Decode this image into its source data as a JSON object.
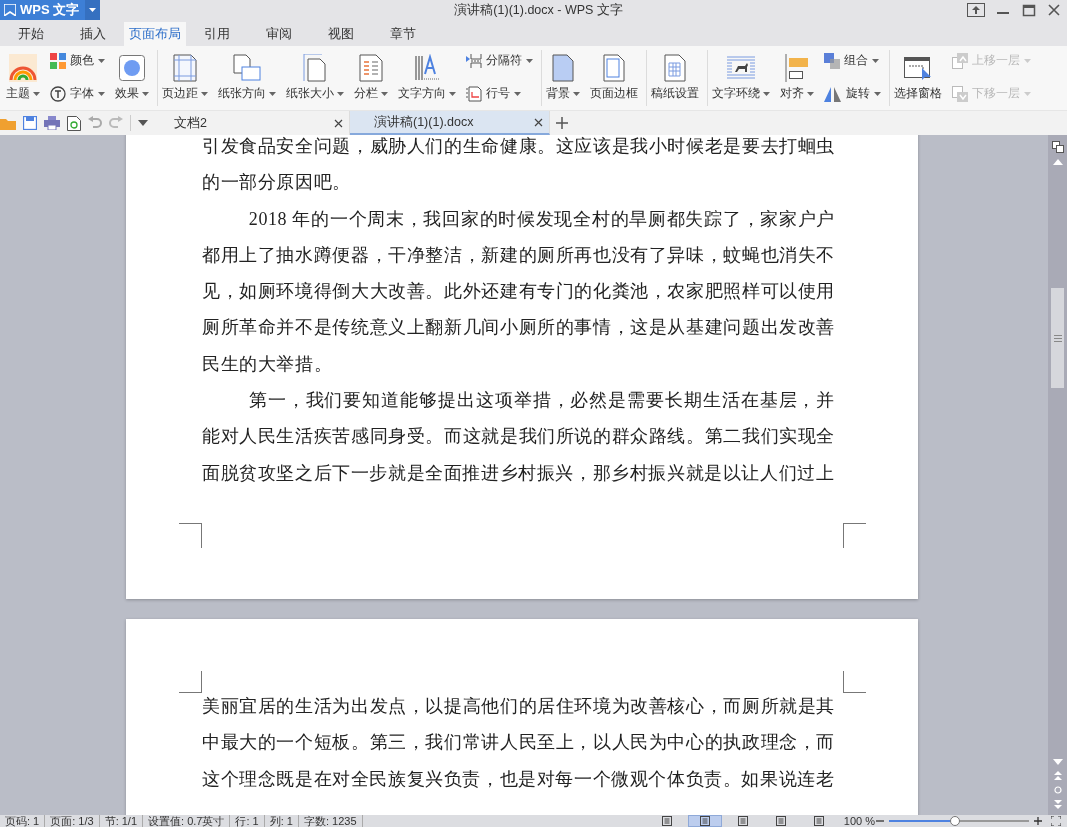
{
  "window": {
    "app_name": "WPS 文字",
    "title": "演讲稿(1)(1).docx - WPS 文字"
  },
  "tabs": [
    {
      "label": "开始",
      "selected": false
    },
    {
      "label": "插入",
      "selected": false
    },
    {
      "label": "页面布局",
      "selected": true
    },
    {
      "label": "引用",
      "selected": false
    },
    {
      "label": "审阅",
      "selected": false
    },
    {
      "label": "视图",
      "selected": false
    },
    {
      "label": "章节",
      "selected": false
    }
  ],
  "ribbon": {
    "groups": [
      {
        "items": [
          {
            "kind": "large",
            "label": "主题",
            "dropdown": true,
            "disabled": false
          },
          {
            "kind": "stack",
            "items": [
              {
                "label": "颜色",
                "dropdown": true,
                "disabled": false
              },
              {
                "label": "字体",
                "dropdown": true,
                "disabled": false
              }
            ]
          },
          {
            "kind": "large",
            "label": "效果",
            "dropdown": true,
            "disabled": false
          }
        ]
      },
      {
        "items": [
          {
            "kind": "large",
            "label": "页边距",
            "dropdown": true,
            "disabled": false
          },
          {
            "kind": "large",
            "label": "纸张方向",
            "dropdown": true,
            "disabled": false
          },
          {
            "kind": "large",
            "label": "纸张大小",
            "dropdown": true,
            "disabled": false
          },
          {
            "kind": "large",
            "label": "分栏",
            "dropdown": true,
            "disabled": false
          },
          {
            "kind": "large",
            "label": "文字方向",
            "dropdown": true,
            "disabled": false
          },
          {
            "kind": "stack",
            "items": [
              {
                "label": "分隔符",
                "dropdown": true,
                "disabled": false
              },
              {
                "label": "行号",
                "dropdown": true,
                "disabled": false
              }
            ]
          }
        ]
      },
      {
        "items": [
          {
            "kind": "large",
            "label": "背景",
            "dropdown": true,
            "disabled": false
          },
          {
            "kind": "large",
            "label": "页面边框",
            "dropdown": false,
            "disabled": false
          }
        ]
      },
      {
        "items": [
          {
            "kind": "large",
            "label": "稿纸设置",
            "dropdown": false,
            "disabled": false
          }
        ]
      },
      {
        "items": [
          {
            "kind": "large",
            "label": "文字环绕",
            "dropdown": true,
            "disabled": false
          },
          {
            "kind": "large",
            "label": "对齐",
            "dropdown": true,
            "disabled": false
          },
          {
            "kind": "stack",
            "items": [
              {
                "label": "组合",
                "dropdown": true,
                "disabled": false
              },
              {
                "label": "旋转",
                "dropdown": true,
                "disabled": false
              }
            ]
          }
        ]
      },
      {
        "items": [
          {
            "kind": "large",
            "label": "选择窗格",
            "dropdown": false,
            "disabled": false
          },
          {
            "kind": "stack",
            "items": [
              {
                "label": "上移一层",
                "dropdown": true,
                "disabled": true
              },
              {
                "label": "下移一层",
                "dropdown": true,
                "disabled": true
              }
            ]
          }
        ]
      }
    ]
  },
  "document_tabs": [
    {
      "label": "文档2",
      "selected": false
    },
    {
      "label": "演讲稿(1)(1).docx",
      "selected": true
    }
  ],
  "pages": [
    {
      "paragraphs": [
        {
          "kind": "continued",
          "text": "引发食品安全问题，威胁人们的生命健康。这应该是我小时候老是要去打蛔虫的一部分原因吧。"
        },
        {
          "kind": "indented",
          "text": "2018 年的一个周末，我回家的时候发现全村的旱厕都失踪了，家家户户都用上了抽水蹲便器，干净整洁，新建的厕所再也没有了异味，蚊蝇也消失不见，如厕环境得倒大大改善。此外还建有专门的化粪池，农家肥照样可以使用厕所革命并不是传统意义上翻新几间小厕所的事情，这是从基建问题出发改善民生的大举措。"
        },
        {
          "kind": "indented",
          "text": "第一，我们要知道能够提出这项举措，必然是需要长期生活在基层，并能对人民生活疾苦感同身受。而这就是我们所说的群众路线。第二我们实现全面脱贫攻坚之后下一步就是全面推进乡村振兴，那乡村振兴就是以让人们过上"
        }
      ]
    },
    {
      "paragraphs": [
        {
          "kind": "continued",
          "text": "美丽宜居的生活为出发点，以提高他们的居住环境为改善核心，而厕所就是其中最大的一个短板。第三，我们常讲人民至上，以人民为中心的执政理念，而这个理念既是在对全民族复兴负责，也是对每一个微观个体负责。如果说连老"
        }
      ]
    }
  ],
  "status_bar": {
    "fields": [
      "页码: 1",
      "页面: 1/3",
      "节: 1/1",
      "设置值: 0.7英寸",
      "行: 1",
      "列: 1",
      "字数: 1235"
    ],
    "views": [
      {
        "selected": false
      },
      {
        "selected": true
      },
      {
        "selected": false
      },
      {
        "selected": false
      },
      {
        "selected": false
      }
    ],
    "zoom": {
      "reading": "100 %",
      "level": 0.47
    }
  }
}
